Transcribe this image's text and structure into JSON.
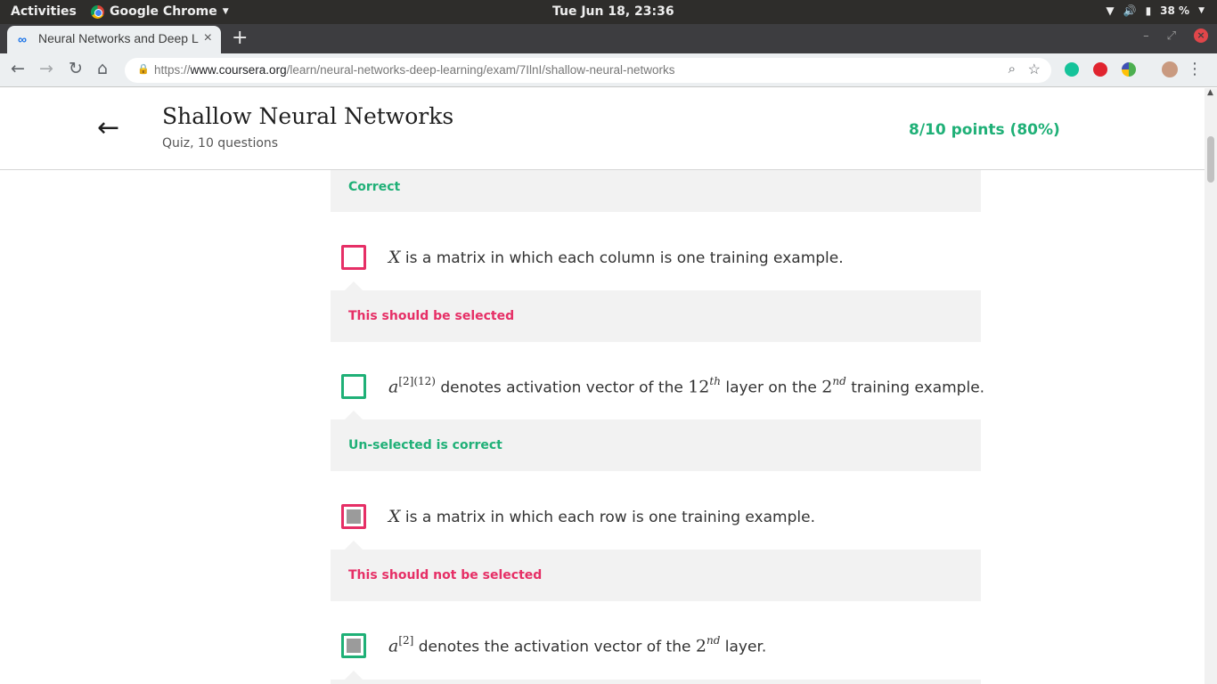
{
  "system_bar": {
    "activities": "Activities",
    "app_name": "Google Chrome",
    "clock": "Tue Jun 18, 23:36",
    "battery": "38 %"
  },
  "browser": {
    "tab_title": "Neural Networks and Deep Learning",
    "new_tab": "+",
    "url_prefix": "https://",
    "url_host": "www.coursera.org",
    "url_path": "/learn/neural-networks-deep-learning/exam/7IlnI/shallow-neural-networks"
  },
  "quiz": {
    "back": "←",
    "title": "Shallow Neural Networks",
    "subtitle": "Quiz, 10 questions",
    "score": "8/10 points (80%)"
  },
  "feedback": {
    "top": "Correct",
    "f1": "This should be selected",
    "f2": "Un-selected is correct",
    "f3": "This should not be selected"
  },
  "options": [
    {
      "pre": "X",
      "text": " is a matrix in which each column is one training example."
    },
    {
      "pre": "a",
      "sup": "[2](12)",
      "text_a": " denotes activation vector of the ",
      "num1": "12",
      "sup1": "th",
      "text_b": " layer on the ",
      "num2": "2",
      "sup2": "nd",
      "text_c": " training example."
    },
    {
      "pre": "X",
      "text": " is a matrix in which each row is one training example."
    },
    {
      "pre": "a",
      "sup": "[2]",
      "text_a": " denotes the activation vector of the ",
      "num1": "2",
      "sup1": "nd",
      "text_b": " layer."
    }
  ],
  "colors": {
    "correct": "#1fb077",
    "wrong": "#e62f66"
  }
}
